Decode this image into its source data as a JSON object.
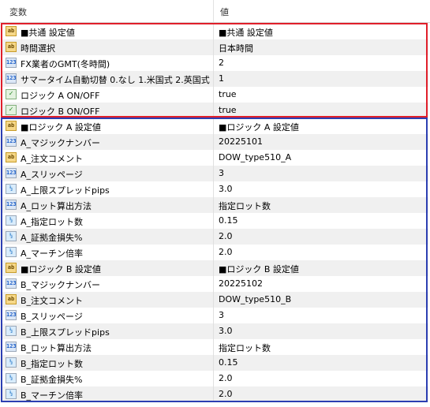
{
  "header": {
    "variable": "変数",
    "value": "値"
  },
  "colors": {
    "red_box": "#e01f2a",
    "blue_box": "#2c3fb2"
  },
  "rows": [
    {
      "icon": "ab",
      "name": "■共通 設定値",
      "value": "■共通 設定値"
    },
    {
      "icon": "ab",
      "name": "時間選択",
      "value": "日本時間"
    },
    {
      "icon": "123",
      "name": "FX業者のGMT(冬時間)",
      "value": "2"
    },
    {
      "icon": "123",
      "name": "サマータイム自動切替 0.なし 1.米国式 2.英国式",
      "value": "1"
    },
    {
      "icon": "bool",
      "name": "ロジック A  ON/OFF",
      "value": "true"
    },
    {
      "icon": "bool",
      "name": "ロジック B  ON/OFF",
      "value": "true"
    },
    {
      "icon": "ab",
      "name": "■ロジック A  設定値",
      "value": "■ロジック A  設定値"
    },
    {
      "icon": "123",
      "name": "A_マジックナンバー",
      "value": "20225101"
    },
    {
      "icon": "ab",
      "name": "A_注文コメント",
      "value": "DOW_type510_A"
    },
    {
      "icon": "123",
      "name": "A_スリッページ",
      "value": "3"
    },
    {
      "icon": "v12",
      "name": "A_上限スプレッドpips",
      "value": "3.0"
    },
    {
      "icon": "123",
      "name": "A_ロット算出方法",
      "value": "指定ロット数"
    },
    {
      "icon": "v12",
      "name": "A_指定ロット数",
      "value": "0.15"
    },
    {
      "icon": "v12",
      "name": "A_証拠金損失%",
      "value": "2.0"
    },
    {
      "icon": "v12",
      "name": "A_マーチン倍率",
      "value": "2.0"
    },
    {
      "icon": "ab",
      "name": "■ロジック B  設定値",
      "value": "■ロジック B  設定値"
    },
    {
      "icon": "123",
      "name": "B_マジックナンバー",
      "value": "20225102"
    },
    {
      "icon": "ab",
      "name": "B_注文コメント",
      "value": "DOW_type510_B"
    },
    {
      "icon": "123",
      "name": "B_スリッページ",
      "value": "3"
    },
    {
      "icon": "v12",
      "name": "B_上限スプレッドpips",
      "value": "3.0"
    },
    {
      "icon": "123",
      "name": "B_ロット算出方法",
      "value": "指定ロット数"
    },
    {
      "icon": "v12",
      "name": "B_指定ロット数",
      "value": "0.15"
    },
    {
      "icon": "v12",
      "name": "B_証拠金損失%",
      "value": "2.0"
    },
    {
      "icon": "v12",
      "name": "B_マーチン倍率",
      "value": "2.0"
    }
  ]
}
